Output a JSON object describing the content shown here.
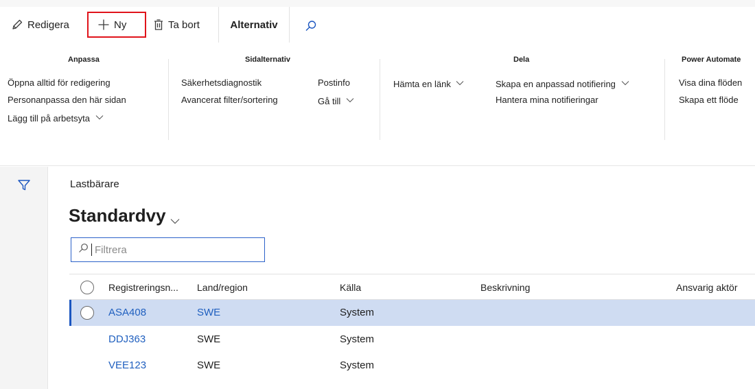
{
  "actionbar": {
    "edit_label": "Redigera",
    "new_label": "Ny",
    "delete_label": "Ta bort",
    "options_tab_label": "Alternativ"
  },
  "ribbon": {
    "groups": [
      {
        "title": "Anpassa",
        "items": [
          "Öppna alltid för redigering",
          "Personanpassa den här sidan",
          "Lägg till på arbetsyta"
        ]
      },
      {
        "title": "Sidalternativ",
        "items": [
          "Säkerhetsdiagnostik",
          "Avancerat filter/sortering",
          "Postinfo",
          "Gå till"
        ]
      },
      {
        "title": "Dela",
        "items": [
          "Hämta en länk",
          "Skapa en anpassad notifiering",
          "Hantera mina notifieringar"
        ]
      },
      {
        "title": "Power Automate",
        "items": [
          "Visa dina flöden",
          "Skapa ett flöde"
        ]
      }
    ]
  },
  "page": {
    "caption": "Lastbärare",
    "view_name": "Standardvy",
    "filter_placeholder": "Filtrera"
  },
  "grid": {
    "columns": [
      "Registreringsn...",
      "Land/region",
      "Källa",
      "Beskrivning",
      "Ansvarig aktör"
    ],
    "rows": [
      {
        "reg": "ASA408",
        "land": "SWE",
        "kalla": "System",
        "beskrivning": "",
        "ansvarig": "",
        "selected": true
      },
      {
        "reg": "DDJ363",
        "land": "SWE",
        "kalla": "System",
        "beskrivning": "",
        "ansvarig": "",
        "selected": false
      },
      {
        "reg": "VEE123",
        "land": "SWE",
        "kalla": "System",
        "beskrivning": "",
        "ansvarig": "",
        "selected": false
      }
    ]
  },
  "colors": {
    "accent": "#1b56c0",
    "link": "#1f5fbf",
    "selected_row": "#cfdcf2",
    "highlight_box": "#e0131a"
  },
  "icons": [
    "pencil-icon",
    "plus-icon",
    "trash-icon",
    "search-icon",
    "filter-icon",
    "chevron-down-icon"
  ]
}
